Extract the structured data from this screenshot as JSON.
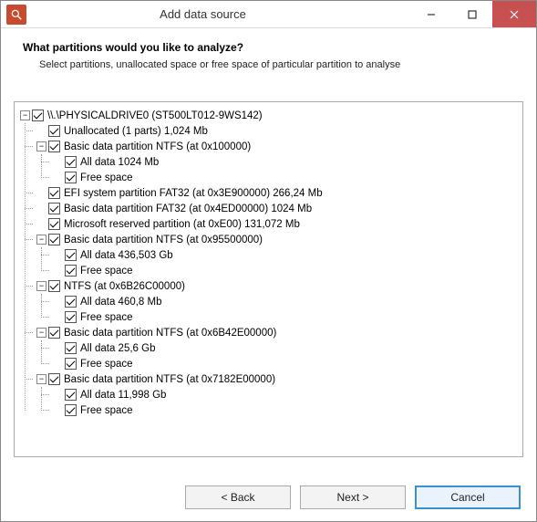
{
  "window": {
    "title": "Add data source"
  },
  "header": {
    "question": "What partitions would you like to analyze?",
    "instruction": "Select partitions, unallocated space or free space of particular partition to analyse"
  },
  "tree": {
    "root": {
      "label": "\\\\.\\PHYSICALDRIVE0 (ST500LT012-9WS142)",
      "checked": true,
      "expanded": true,
      "children": [
        {
          "label": "Unallocated (1 parts) 1,024 Mb",
          "checked": true
        },
        {
          "label": "Basic data partition NTFS (at 0x100000)",
          "checked": true,
          "expanded": true,
          "children": [
            {
              "label": "All data 1024 Mb",
              "checked": true
            },
            {
              "label": "Free space",
              "checked": true
            }
          ]
        },
        {
          "label": "EFI system partition FAT32 (at 0x3E900000) 266,24 Mb",
          "checked": true
        },
        {
          "label": "Basic data partition FAT32 (at 0x4ED00000) 1024 Mb",
          "checked": true
        },
        {
          "label": "Microsoft reserved partition (at 0xE00) 131,072 Mb",
          "checked": true
        },
        {
          "label": "Basic data partition NTFS (at 0x95500000)",
          "checked": true,
          "expanded": true,
          "children": [
            {
              "label": "All data 436,503 Gb",
              "checked": true
            },
            {
              "label": "Free space",
              "checked": true
            }
          ]
        },
        {
          "label": "NTFS (at 0x6B26C00000)",
          "checked": true,
          "expanded": true,
          "children": [
            {
              "label": "All data 460,8 Mb",
              "checked": true
            },
            {
              "label": "Free space",
              "checked": true
            }
          ]
        },
        {
          "label": "Basic data partition NTFS (at 0x6B42E00000)",
          "checked": true,
          "expanded": true,
          "children": [
            {
              "label": "All data 25,6 Gb",
              "checked": true
            },
            {
              "label": "Free space",
              "checked": true
            }
          ]
        },
        {
          "label": "Basic data partition NTFS (at 0x7182E00000)",
          "checked": true,
          "expanded": true,
          "children": [
            {
              "label": "All data 11,998 Gb",
              "checked": true
            },
            {
              "label": "Free space",
              "checked": true
            }
          ]
        }
      ]
    }
  },
  "footer": {
    "back": "< Back",
    "next": "Next >",
    "cancel": "Cancel"
  }
}
